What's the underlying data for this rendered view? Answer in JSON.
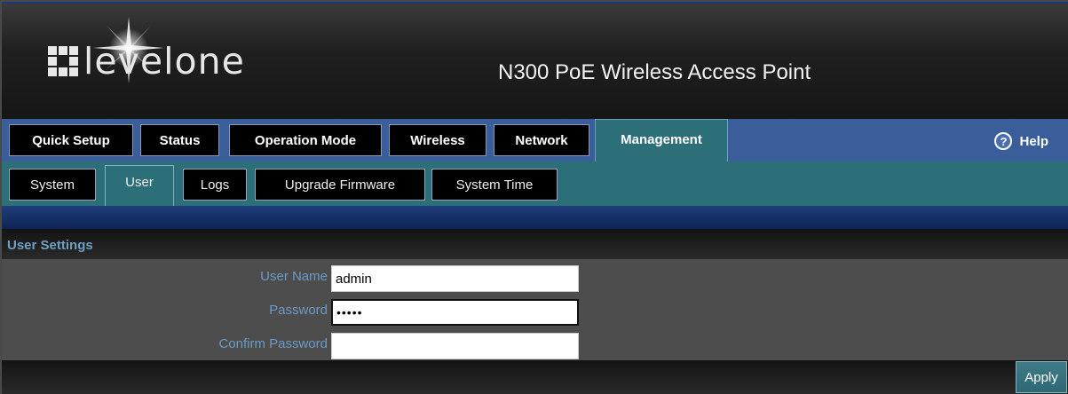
{
  "header": {
    "logo_text": "levelone",
    "product_title": "N300 PoE Wireless Access Point"
  },
  "top_nav": {
    "tabs": [
      {
        "label": "Quick Setup"
      },
      {
        "label": "Status"
      },
      {
        "label": "Operation Mode"
      },
      {
        "label": "Wireless"
      },
      {
        "label": "Network"
      },
      {
        "label": "Management"
      }
    ],
    "active": "Management",
    "help_label": "Help",
    "help_icon": "question-circle-icon"
  },
  "sub_nav": {
    "tabs": [
      {
        "label": "System"
      },
      {
        "label": "User"
      },
      {
        "label": "Logs"
      },
      {
        "label": "Upgrade Firmware"
      },
      {
        "label": "System Time"
      }
    ],
    "active": "User"
  },
  "section": {
    "title": "User Settings"
  },
  "form": {
    "username_label": "User Name",
    "username_value": "admin",
    "password_label": "Password",
    "password_value": "•••••",
    "confirm_label": "Confirm Password",
    "confirm_value": ""
  },
  "footer": {
    "apply_label": "Apply"
  },
  "colors": {
    "header_bg": "#1b1b1b",
    "top_nav_bg": "#3a5e9a",
    "sub_nav_bg": "#2d6f79",
    "label_color": "#6b9ac6",
    "form_bg": "#4d4d4d"
  }
}
